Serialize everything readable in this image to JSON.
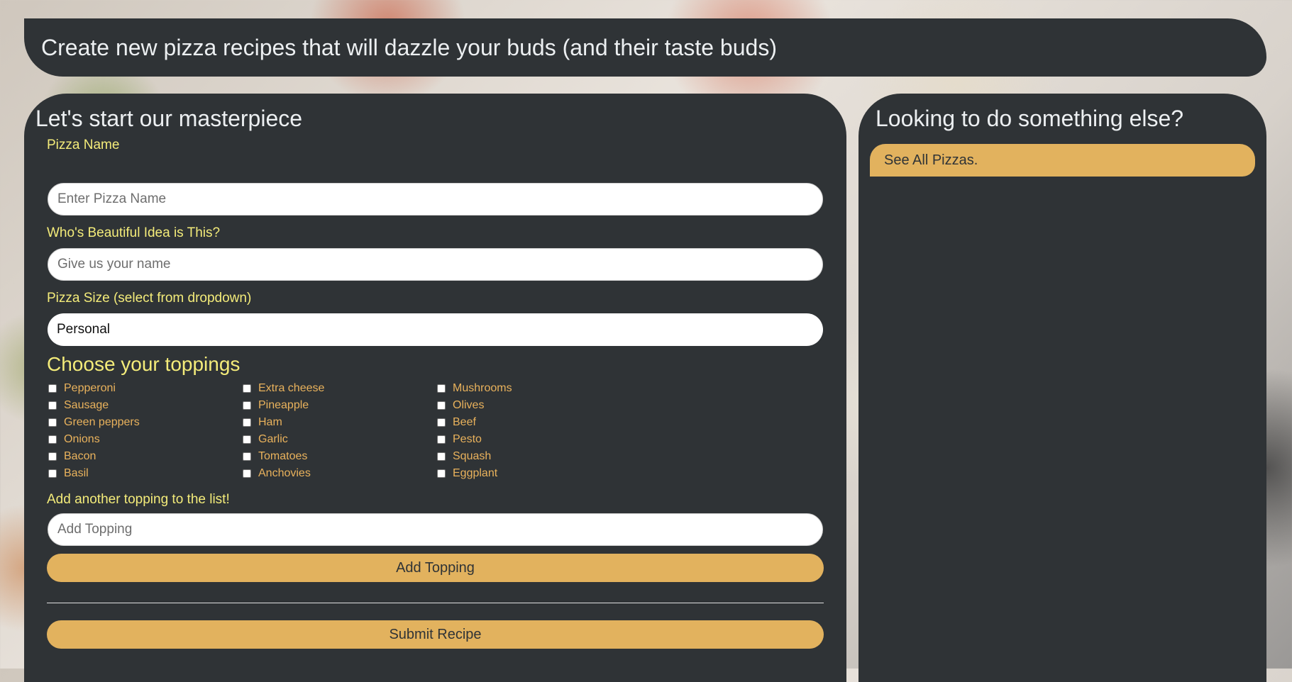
{
  "header": {
    "title": "Create new pizza recipes that will dazzle your buds (and their taste buds)"
  },
  "form": {
    "heading": "Let's start our masterpiece",
    "pizza_name": {
      "label": "Pizza Name",
      "placeholder": "Enter Pizza Name",
      "value": ""
    },
    "creator": {
      "label": "Who's Beautiful Idea is This?",
      "placeholder": "Give us your name",
      "value": ""
    },
    "size": {
      "label": "Pizza Size (select from dropdown)",
      "selected": "Personal"
    },
    "toppings_heading": "Choose your toppings",
    "toppings": [
      "Pepperoni",
      "Extra cheese",
      "Mushrooms",
      "Sausage",
      "Pineapple",
      "Olives",
      "Green peppers",
      "Ham",
      "Beef",
      "Onions",
      "Garlic",
      "Pesto",
      "Bacon",
      "Tomatoes",
      "Squash",
      "Basil",
      "Anchovies",
      "Eggplant"
    ],
    "add_topping": {
      "label": "Add another topping to the list!",
      "placeholder": "Add Topping",
      "value": "",
      "button_label": "Add Topping"
    },
    "submit_label": "Submit Recipe"
  },
  "sidebar": {
    "heading": "Looking to do something else?",
    "link_label": "See All Pizzas."
  },
  "colors": {
    "panel": "#2f3336",
    "accent": "#e2b25e",
    "label_yellow": "#f4ec7a",
    "topping_text": "#e9b25c",
    "heading_text": "#eceff1"
  }
}
